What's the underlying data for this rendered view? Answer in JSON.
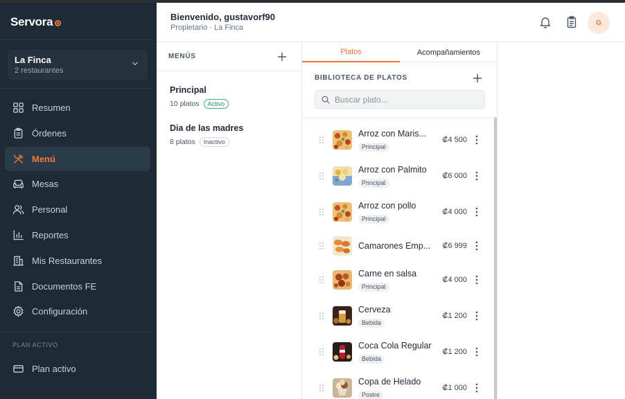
{
  "brand": {
    "name": "Servora",
    "accent": "#f07a3a"
  },
  "org": {
    "name": "La Finca",
    "sub": "2 restaurantes"
  },
  "nav": [
    {
      "label": "Resumen",
      "icon": "grid-icon"
    },
    {
      "label": "Órdenes",
      "icon": "clipboard-icon"
    },
    {
      "label": "Menú",
      "icon": "utensils-icon",
      "active": true
    },
    {
      "label": "Mesas",
      "icon": "sofa-icon"
    },
    {
      "label": "Personal",
      "icon": "users-icon"
    },
    {
      "label": "Reportes",
      "icon": "bar-chart-icon"
    },
    {
      "label": "Mis Restaurantes",
      "icon": "building-icon"
    },
    {
      "label": "Documentos FE",
      "icon": "document-icon"
    },
    {
      "label": "Configuración",
      "icon": "gear-icon"
    }
  ],
  "plan": {
    "section_label": "PLAN ACTIVO",
    "item_label": "Plan activo"
  },
  "header": {
    "welcome": "Bienvenido, gustavorf90",
    "subline": "Propietario · La Finca",
    "avatar_initial": "G"
  },
  "menus": {
    "title": "MENÚS",
    "items": [
      {
        "name": "Principal",
        "count": "10 platos",
        "status": "Activo"
      },
      {
        "name": "Dia de las madres",
        "count": "8 platos",
        "status": "Inactivo"
      }
    ]
  },
  "dishes": {
    "tabs": [
      {
        "label": "Platos",
        "active": true
      },
      {
        "label": "Acompañamientos",
        "active": false
      }
    ],
    "library_title": "BIBLIOTECA DE PLATOS",
    "search_placeholder": "Buscar plato...",
    "items": [
      {
        "name": "Arroz con Maris...",
        "category": "Principal",
        "price": "₡4 500",
        "thumb": "rice"
      },
      {
        "name": "Arroz con Palmito",
        "category": "Principal",
        "price": "₡6 000",
        "thumb": "palmito"
      },
      {
        "name": "Arroz con pollo",
        "category": "Principal",
        "price": "₡4 000",
        "thumb": "rice"
      },
      {
        "name": "Camarones Emp...",
        "category": "",
        "price": "₡6 999",
        "thumb": "shrimp"
      },
      {
        "name": "Carne en salsa",
        "category": "Principal",
        "price": "₡4 000",
        "thumb": "meat"
      },
      {
        "name": "Cerveza",
        "category": "Bebida",
        "price": "₡1 200",
        "thumb": "beer"
      },
      {
        "name": "Coca Cola Regular",
        "category": "Bebida",
        "price": "₡1 200",
        "thumb": "cola"
      },
      {
        "name": "Copa de Helado",
        "category": "Postre",
        "price": "₡1 000",
        "thumb": "icecream"
      }
    ]
  }
}
